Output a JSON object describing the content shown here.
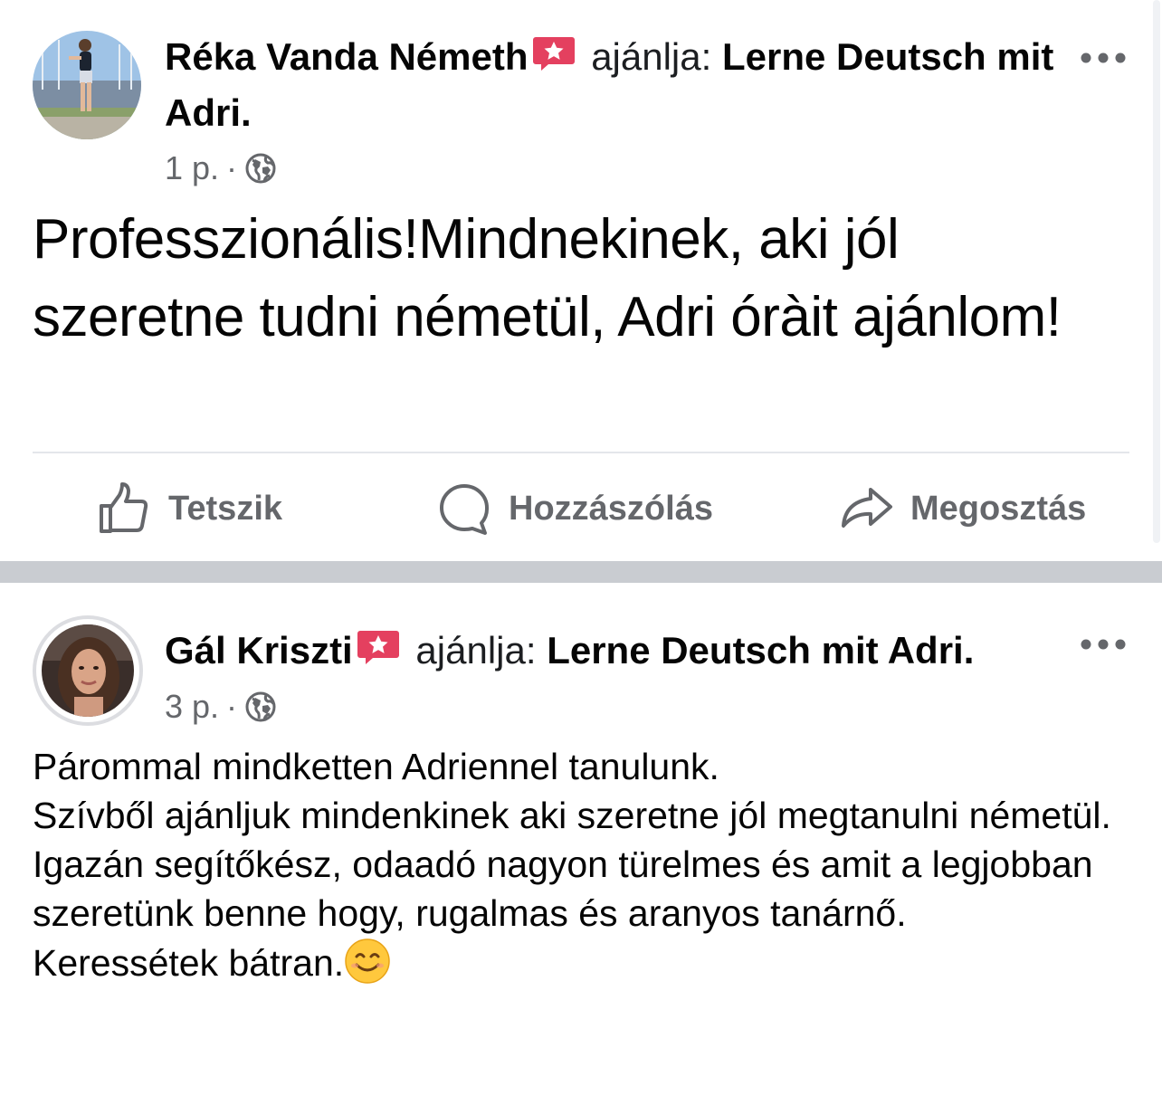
{
  "posts": [
    {
      "author": "Réka Vanda Németh",
      "verb": "ajánlja:",
      "page": "Lerne Deutsch mit Adri.",
      "time": "1 p.",
      "separator_dot": "·",
      "text": "Professzionális!Mindnekinek, aki jól szeretne tudni németül, Adri óràit ajánlom!",
      "actions": {
        "like": "Tetszik",
        "comment": "Hozzászólás",
        "share": "Megosztás"
      }
    },
    {
      "author": "Gál Kriszti",
      "verb": "ajánlja:",
      "page": "Lerne Deutsch mit Adri.",
      "time": "3 p.",
      "separator_dot": "·",
      "lines": [
        "Párommal mindketten Adriennel tanulunk.",
        "Szívből ajánljuk mindenkinek aki szeretne jól megtanulni németül.",
        "Igazán segítőkész, odaadó nagyon türelmes és amit a legjobban szeretünk benne hogy, rugalmas és aranyos tanárnő.",
        "Keressétek bátran."
      ]
    }
  ],
  "icons": {
    "recommend": "recommend-badge-icon",
    "privacy": "globe-icon",
    "more": "more-options-icon",
    "like": "thumbs-up-icon",
    "comment": "comment-bubble-icon",
    "share": "share-arrow-icon",
    "emoji": "smiling-face-emoji"
  },
  "colors": {
    "recommend_badge": "#e4405f",
    "secondary_text": "#65676b",
    "separator": "#c9ccd1"
  }
}
